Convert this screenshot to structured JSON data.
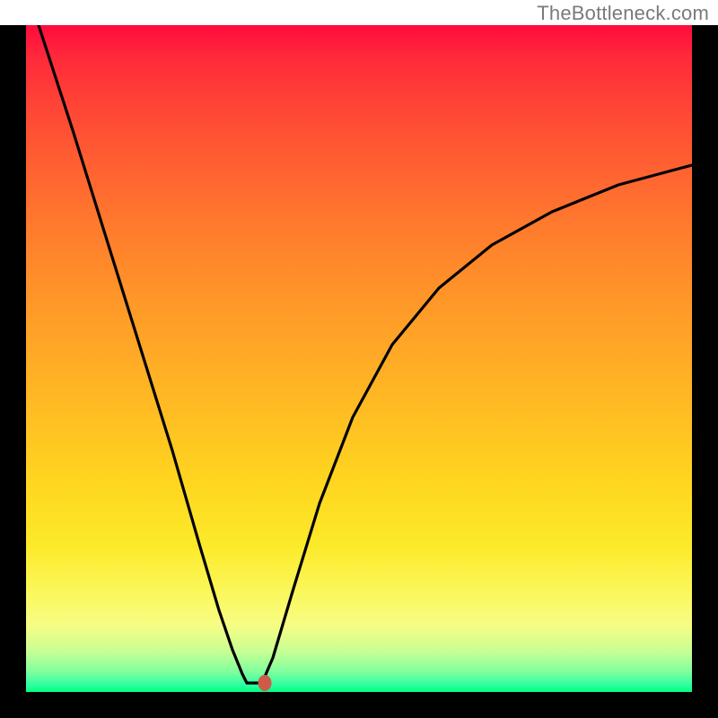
{
  "watermark": "TheBottleneck.com",
  "chart_data": {
    "type": "line",
    "title": "",
    "xlabel": "",
    "ylabel": "",
    "xlim": [
      0,
      100
    ],
    "ylim": [
      0,
      100
    ],
    "grid": false,
    "legend": false,
    "series": [
      {
        "name": "left-branch",
        "x": [
          2,
          7,
          12,
          17,
          22,
          26,
          29,
          31,
          32.5,
          33.2
        ],
        "y": [
          100,
          84,
          68,
          52,
          36,
          22,
          12,
          6,
          2.5,
          1.2
        ]
      },
      {
        "name": "floor",
        "x": [
          33.2,
          35.5
        ],
        "y": [
          1.2,
          1.2
        ]
      },
      {
        "name": "right-branch",
        "x": [
          35.5,
          37,
          40,
          44,
          49,
          55,
          62,
          70,
          79,
          89,
          100
        ],
        "y": [
          1.2,
          5,
          15,
          28,
          41,
          52,
          60.5,
          67,
          72,
          76,
          79
        ]
      }
    ],
    "marker": {
      "x": 35.8,
      "y": 1.2,
      "color": "#cf5a48"
    },
    "background_gradient": {
      "top": "#ff0b3d",
      "mid1": "#ff9928",
      "mid2": "#ffd41f",
      "mid3": "#fcea29",
      "bottom": "#00ff80"
    }
  }
}
